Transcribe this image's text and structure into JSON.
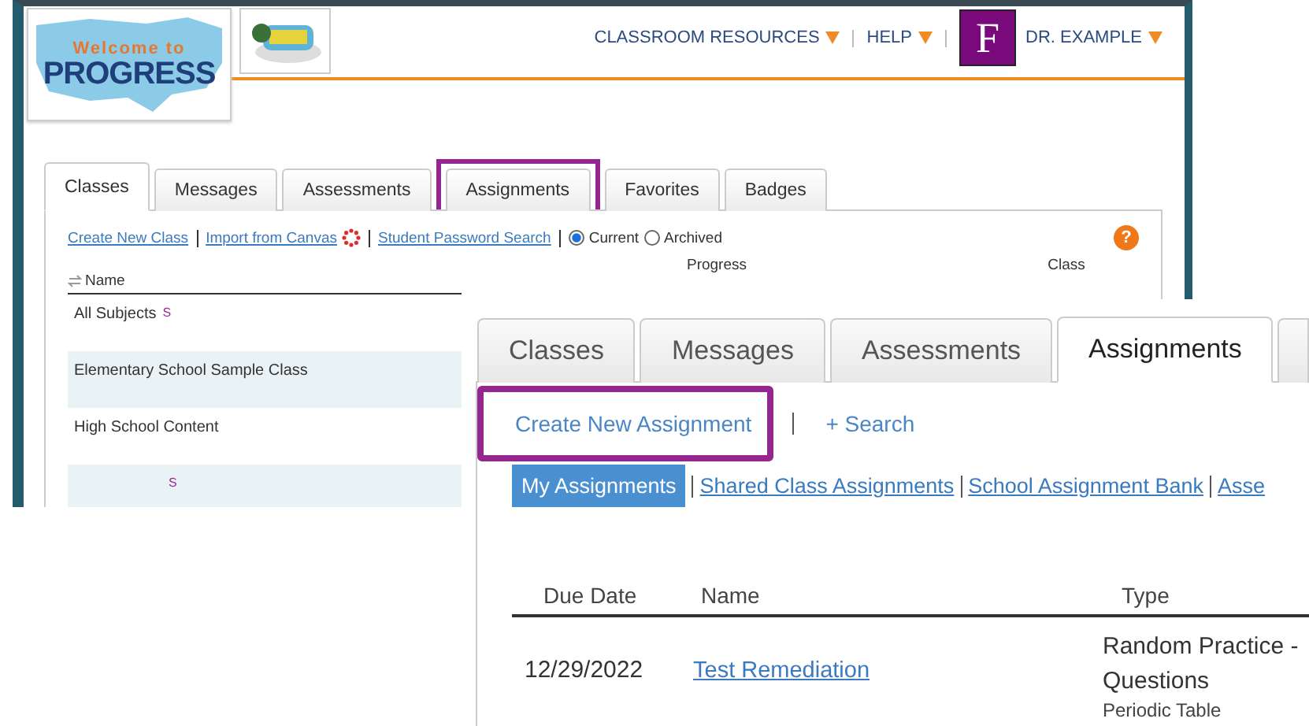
{
  "back_window": {
    "logo": {
      "line_1": "Welcome to",
      "line_2": "PROGRESS"
    },
    "nav": [
      {
        "label": "CLASSROOM RESOURCES"
      },
      {
        "label": "HELP"
      }
    ],
    "avatar_letter": "F",
    "user_menu": "DR. EXAMPLE",
    "tabs": [
      {
        "label": "Classes",
        "selected": true,
        "highlighted": false
      },
      {
        "label": "Messages",
        "selected": false,
        "highlighted": false
      },
      {
        "label": "Assessments",
        "selected": false,
        "highlighted": false
      },
      {
        "label": "Assignments",
        "selected": false,
        "highlighted": true
      },
      {
        "label": "Favorites",
        "selected": false,
        "highlighted": false
      },
      {
        "label": "Badges",
        "selected": false,
        "highlighted": false
      }
    ],
    "links": [
      {
        "label": "Create New Class",
        "kind": "link"
      },
      {
        "label": "Import from Canvas",
        "kind": "link_with_icon"
      },
      {
        "label": "Student Password Search",
        "kind": "link"
      }
    ],
    "help": "?",
    "radios": [
      {
        "label": "Current",
        "selected": true
      },
      {
        "label": "Archived",
        "selected": false
      }
    ],
    "columns": [
      "Name",
      "Progress",
      "Class"
    ],
    "rows": [
      {
        "name": "All Subjects",
        "badge": "S"
      },
      {
        "name": "Elementary School Sample Class"
      },
      {
        "name": "High School Content"
      },
      {
        "badge": "S"
      }
    ]
  },
  "front_window": {
    "tabs": [
      {
        "label": "Classes",
        "selected": false
      },
      {
        "label": "Messages",
        "selected": false
      },
      {
        "label": "Assessments",
        "selected": false
      },
      {
        "label": "Assignments",
        "selected": true
      }
    ],
    "actions": [
      {
        "label": "Create New Assignment",
        "highlighted": true
      },
      {
        "label": "+ Search",
        "highlighted": false
      }
    ],
    "subtabs": [
      {
        "label": "My Assignments",
        "selected": true
      },
      {
        "label": "Shared Class Assignments",
        "selected": false
      },
      {
        "label": "School Assignment Bank",
        "selected": false
      },
      {
        "label": "Asse",
        "selected": false
      }
    ],
    "columns": [
      "Due Date",
      "Name",
      "Type"
    ],
    "rows": [
      {
        "due_date": "12/29/2022",
        "name": "Test Remediation",
        "type": "Random Practice - Questions",
        "subject": "Periodic Table"
      }
    ]
  }
}
